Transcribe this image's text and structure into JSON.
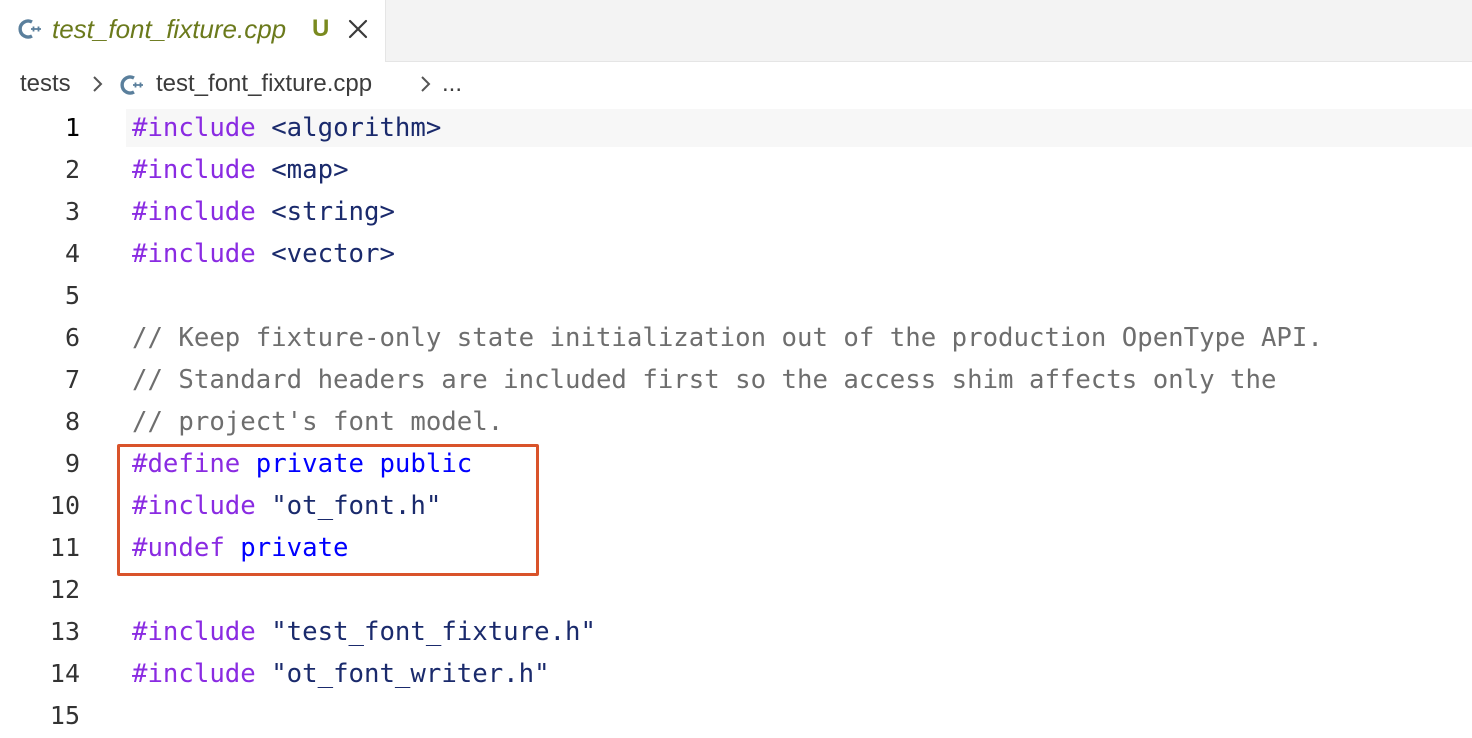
{
  "tab": {
    "icon": "cpp-file-icon",
    "title": "test_font_fixture.cpp",
    "status": "U",
    "close_icon": "close-icon"
  },
  "breadcrumb": {
    "folder": "tests",
    "file": "test_font_fixture.cpp",
    "more": "..."
  },
  "editor": {
    "current_line": 1,
    "lines": [
      {
        "n": "1",
        "tokens": [
          {
            "t": "kw",
            "v": "#include"
          },
          {
            "t": "sp",
            "v": " "
          },
          {
            "t": "inc",
            "v": "<algorithm>"
          }
        ]
      },
      {
        "n": "2",
        "tokens": [
          {
            "t": "kw",
            "v": "#include"
          },
          {
            "t": "sp",
            "v": " "
          },
          {
            "t": "inc",
            "v": "<map>"
          }
        ]
      },
      {
        "n": "3",
        "tokens": [
          {
            "t": "kw",
            "v": "#include"
          },
          {
            "t": "sp",
            "v": " "
          },
          {
            "t": "inc",
            "v": "<string>"
          }
        ]
      },
      {
        "n": "4",
        "tokens": [
          {
            "t": "kw",
            "v": "#include"
          },
          {
            "t": "sp",
            "v": " "
          },
          {
            "t": "inc",
            "v": "<vector>"
          }
        ]
      },
      {
        "n": "5",
        "tokens": []
      },
      {
        "n": "6",
        "tokens": [
          {
            "t": "cm",
            "v": "// Keep fixture-only state initialization out of the production OpenType API."
          }
        ]
      },
      {
        "n": "7",
        "tokens": [
          {
            "t": "cm",
            "v": "// Standard headers are included first so the access shim affects only the"
          }
        ]
      },
      {
        "n": "8",
        "tokens": [
          {
            "t": "cm",
            "v": "// project's font model."
          }
        ]
      },
      {
        "n": "9",
        "tokens": [
          {
            "t": "kw",
            "v": "#define"
          },
          {
            "t": "sp",
            "v": " "
          },
          {
            "t": "mac",
            "v": "private"
          },
          {
            "t": "sp",
            "v": " "
          },
          {
            "t": "mac",
            "v": "public"
          }
        ]
      },
      {
        "n": "10",
        "tokens": [
          {
            "t": "kw",
            "v": "#include"
          },
          {
            "t": "sp",
            "v": " "
          },
          {
            "t": "str",
            "v": "\"ot_font.h\""
          }
        ]
      },
      {
        "n": "11",
        "tokens": [
          {
            "t": "kw",
            "v": "#undef"
          },
          {
            "t": "sp",
            "v": " "
          },
          {
            "t": "mac",
            "v": "private"
          }
        ]
      },
      {
        "n": "12",
        "tokens": []
      },
      {
        "n": "13",
        "tokens": [
          {
            "t": "kw",
            "v": "#include"
          },
          {
            "t": "sp",
            "v": " "
          },
          {
            "t": "str",
            "v": "\"test_font_fixture.h\""
          }
        ]
      },
      {
        "n": "14",
        "tokens": [
          {
            "t": "kw",
            "v": "#include"
          },
          {
            "t": "sp",
            "v": " "
          },
          {
            "t": "str",
            "v": "\"ot_font_writer.h\""
          }
        ]
      },
      {
        "n": "15",
        "tokens": []
      }
    ]
  },
  "colors": {
    "keyword": "#8a2be2",
    "include_path": "#1a2a6c",
    "comment": "#6e6e6e",
    "macro": "#0000ff",
    "highlight_box": "#d9532a",
    "tab_title": "#6b7a1c"
  }
}
